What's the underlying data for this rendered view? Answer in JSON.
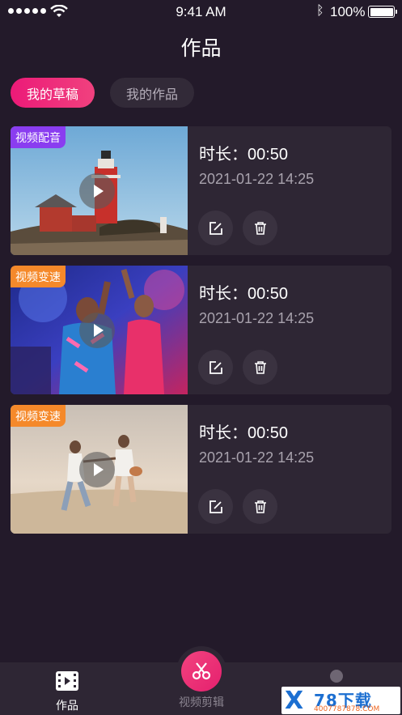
{
  "status_bar": {
    "time": "9:41 AM",
    "battery": "100%"
  },
  "page": {
    "title": "作品"
  },
  "tabs": [
    {
      "label": "我的草稿",
      "active": true
    },
    {
      "label": "我的作品",
      "active": false
    }
  ],
  "works": [
    {
      "badge": "视频配音",
      "badge_color": "#8a3df0",
      "duration": "时长：00:50",
      "date": "2021-01-22 14:25"
    },
    {
      "badge": "视频变速",
      "badge_color": "#f5892a",
      "duration": "时长：00:50",
      "date": "2021-01-22 14:25"
    },
    {
      "badge": "视频变速",
      "badge_color": "#f5892a",
      "duration": "时长：00:50",
      "date": "2021-01-22 14:25"
    }
  ],
  "nav": {
    "works_label": "作品",
    "edit_label": "视频剪辑"
  },
  "watermark": {
    "brand": "78下载",
    "url": "4007787878.COM"
  },
  "colors": {
    "accent": "#ec1a78",
    "background": "#231a2a",
    "card": "#2e2634"
  }
}
